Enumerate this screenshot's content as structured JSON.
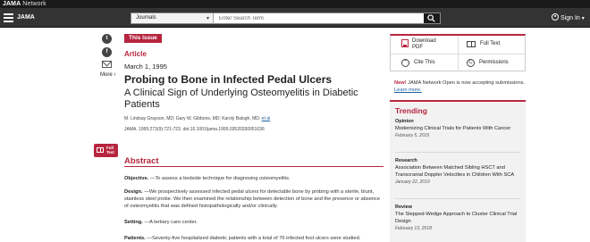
{
  "network_bar": {
    "brand_bold": "JAMA",
    "brand_rest": " Network"
  },
  "header": {
    "logo": "JAMA",
    "search_scope": "Journals",
    "search_placeholder": "Enter Search Term",
    "sign_in": "Sign In"
  },
  "social": {
    "twitter": "t",
    "facebook": "f",
    "more": "More"
  },
  "full_text_button": "Full Text",
  "article": {
    "badge": "This Issue",
    "type": "Article",
    "date": "March 1, 1995",
    "title": "Probing to Bone in Infected Pedal Ulcers",
    "subtitle": "A Clinical Sign of Underlying Osteomyelitis in Diabetic Patients",
    "authors": "M. Lindsay Grayson, MD; Gary W. Gibbons, MD; Karoly Balogh, MD;",
    "authors_more": "et al",
    "citation": "JAMA. 1995;273(9):721-723. doi:10.1001/jama.1995.03520330051036"
  },
  "abstract": {
    "heading": "Abstract",
    "objective_label": "Objective.",
    "objective_text": " —To assess a bedside technique for diagnosing osteomyelitis.",
    "design_label": "Design.",
    "design_text": " —We prospectively assessed infected pedal ulcers for detectable bone by probing with a sterile, blunt, stainless steel probe. We then examined the relationship between detection of bone and the presence or absence of osteomyelitis that was defined histopathologically and/or clinically.",
    "setting_label": "Setting.",
    "setting_text": " —A tertiary care center.",
    "patients_label": "Patients.",
    "patients_text": " —Seventy-five hospitalized diabetic patients with a total of 76 infected foot ulcers were studied."
  },
  "tools": {
    "download_pdf": "Download PDF",
    "full_text": "Full Text",
    "cite_this": "Cite This",
    "permissions": "Permissions"
  },
  "notice": {
    "new_label": "New!",
    "text": " JAMA Network Open is now accepting submissions.",
    "link": "Learn more."
  },
  "trending": {
    "heading": "Trending",
    "items": [
      {
        "category": "Opinion",
        "title": "Modernizing Clinical Trials for Patients With Cancer",
        "date": "February 5, 2019"
      },
      {
        "category": "Research",
        "title": "Association Between Matched Sibling HSCT and Transcranial Doppler Velocities in Children With SCA",
        "date": "January 22, 2019"
      },
      {
        "category": "Review",
        "title": "The Stepped-Wedge Approach to Cluster Clinical Trial Design",
        "date": "February 13, 2018"
      }
    ]
  },
  "colors": {
    "accent": "#b7253f",
    "header": "#333333",
    "network_bar": "#1a1a1a",
    "link": "#1a5e9e"
  }
}
